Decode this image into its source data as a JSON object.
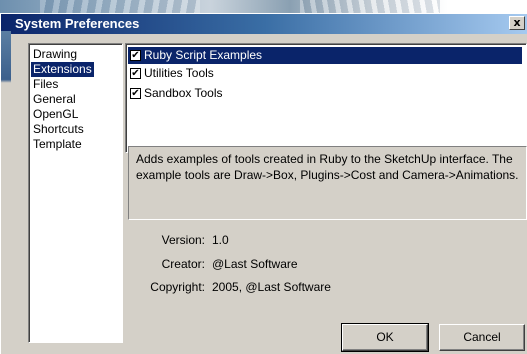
{
  "window": {
    "title": "System Preferences",
    "close_glyph": "x"
  },
  "categories": [
    {
      "label": "Drawing"
    },
    {
      "label": "Extensions",
      "selected": true
    },
    {
      "label": "Files"
    },
    {
      "label": "General"
    },
    {
      "label": "OpenGL"
    },
    {
      "label": "Shortcuts"
    },
    {
      "label": "Template"
    }
  ],
  "extensions": [
    {
      "label": "Ruby Script Examples",
      "checked": true,
      "selected": true
    },
    {
      "label": "Utilities Tools",
      "checked": true,
      "selected": false
    },
    {
      "label": "Sandbox Tools",
      "checked": true,
      "selected": false
    }
  ],
  "description": "Adds examples of tools created in Ruby to the SketchUp interface.  The example tools are Draw->Box, Plugins->Cost and Camera->Animations.",
  "info": {
    "version_label": "Version:",
    "version_value": "1.0",
    "creator_label": "Creator:",
    "creator_value": "@Last Software",
    "copyright_label": "Copyright:",
    "copyright_value": "2005, @Last Software"
  },
  "buttons": {
    "ok_label": "OK",
    "cancel_label": "Cancel"
  },
  "colors": {
    "titlebar_start": "#0a246a",
    "titlebar_end": "#a6caf0",
    "selection": "#0a246a",
    "face": "#d4d0c8"
  }
}
